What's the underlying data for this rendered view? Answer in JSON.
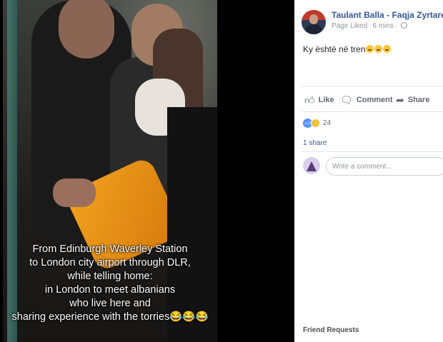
{
  "photo": {
    "caption_lines": [
      "From Edinburgh Waverley Station",
      "to London city airport through DLR,",
      "while telling home:",
      "in London to meet albanians",
      "who live here and",
      "sharing experience with the torries😂😂😂"
    ]
  },
  "post": {
    "page_name": "Taulant Balla - Faqja Zyrtare",
    "liked_status": "Page Liked",
    "time": "6 mins",
    "text": "Ky është në tren",
    "text_emoji_count": 3
  },
  "actions": {
    "like_label": "Like",
    "comment_label": "Comment",
    "share_label": "Share"
  },
  "reactions": {
    "count": "24"
  },
  "shares": {
    "label": "1 share"
  },
  "comment": {
    "placeholder": "Write a comment..."
  },
  "sidebar": {
    "friend_requests_label": "Friend Requests"
  },
  "colors": {
    "link": "#365899",
    "muted": "#90949c",
    "action": "#616770",
    "like_blue": "#5890ff",
    "haha_yellow": "#f7c23a",
    "bag_orange": "#f2a21f"
  },
  "icons": [
    "globe-icon",
    "like-icon",
    "comment-icon",
    "share-icon",
    "like-reaction-icon",
    "haha-reaction-icon"
  ]
}
